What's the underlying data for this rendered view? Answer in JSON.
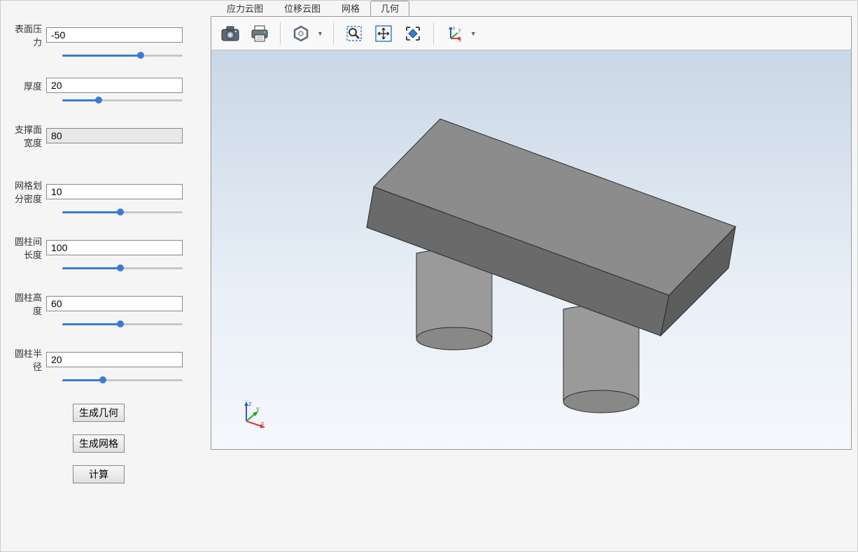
{
  "params": {
    "surface_pressure": {
      "label": "表面压力",
      "value": "-50",
      "fill": 65
    },
    "thickness": {
      "label": "厚度",
      "value": "20",
      "fill": 30
    },
    "support_width": {
      "label": "支撑面宽度",
      "value": "80",
      "readonly": true
    },
    "mesh_density": {
      "label": "网格划分密度",
      "value": "10",
      "fill": 48
    },
    "column_spacing": {
      "label": "圆柱间长度",
      "value": "100",
      "fill": 48
    },
    "column_height": {
      "label": "圆柱高度",
      "value": "60",
      "fill": 48
    },
    "column_radius": {
      "label": "圆柱半径",
      "value": "20",
      "fill": 34
    }
  },
  "buttons": {
    "gen_geom": "生成几何",
    "gen_mesh": "生成网格",
    "compute": "计算"
  },
  "tabs": {
    "stress": "应力云图",
    "displacement": "位移云图",
    "mesh": "网格",
    "geometry": "几何"
  },
  "toolbar": {
    "camera": "camera",
    "print": "print",
    "quality": "quality",
    "zoom_window": "zoom-window",
    "zoom_fit": "zoom-fit",
    "zoom_sel": "zoom-selection",
    "axis_view": "axis-view"
  },
  "axes": {
    "x": "x",
    "y": "y",
    "z": "z"
  }
}
